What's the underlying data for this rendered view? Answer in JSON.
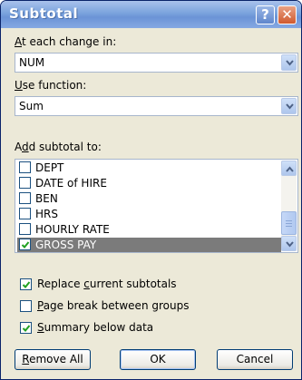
{
  "dialog": {
    "title": "Subtotal",
    "help_glyph": "?",
    "close_glyph": "✕"
  },
  "change_in": {
    "label_prefix": "",
    "label_accel": "A",
    "label_rest": "t each change in:",
    "value": "NUM"
  },
  "use_function": {
    "label_accel": "U",
    "label_rest": "se function:",
    "value": "Sum"
  },
  "add_subtotal": {
    "label_prefix": "A",
    "label_accel": "d",
    "label_rest": "d subtotal to:",
    "items": [
      {
        "label": "DEPT",
        "checked": false,
        "selected": false
      },
      {
        "label": "DATE of HIRE",
        "checked": false,
        "selected": false
      },
      {
        "label": "BEN",
        "checked": false,
        "selected": false
      },
      {
        "label": "HRS",
        "checked": false,
        "selected": false
      },
      {
        "label": "HOURLY RATE",
        "checked": false,
        "selected": false
      },
      {
        "label": "GROSS PAY",
        "checked": true,
        "selected": true
      }
    ]
  },
  "options": {
    "replace": {
      "prefix": "Replace ",
      "accel": "c",
      "rest": "urrent subtotals",
      "checked": true
    },
    "page_break": {
      "prefix": "",
      "accel": "P",
      "rest": "age break between groups",
      "checked": false
    },
    "summary": {
      "prefix": "",
      "accel": "S",
      "rest": "ummary below data",
      "checked": true
    }
  },
  "buttons": {
    "remove_accel": "R",
    "remove_rest": "emove All",
    "ok": "OK",
    "cancel": "Cancel"
  },
  "colors": {
    "accent": "#7aa3dd",
    "selection": "#7b7b7b",
    "check": "#21a121"
  }
}
